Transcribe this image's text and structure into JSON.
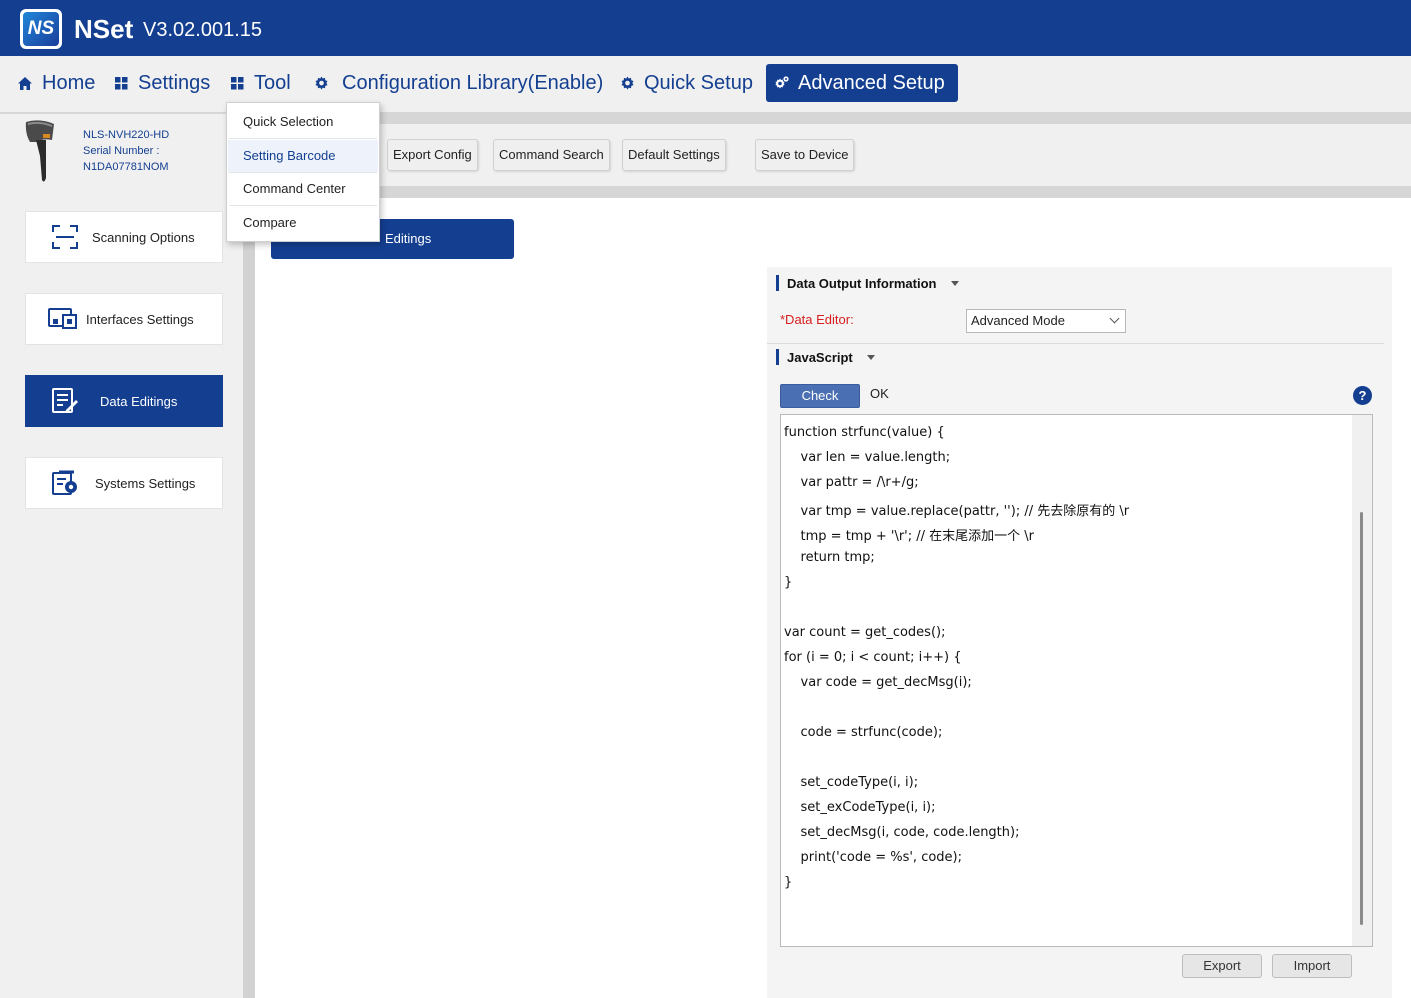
{
  "app": {
    "logo_text": "NS",
    "name": "NSet",
    "version": "V3.02.001.15"
  },
  "nav": [
    {
      "label": "Home",
      "icon": "home-icon"
    },
    {
      "label": "Settings",
      "icon": "grid-icon"
    },
    {
      "label": "Tool",
      "icon": "grid-icon"
    },
    {
      "label": "Configuration Library(Enable)",
      "icon": "gear-icon"
    },
    {
      "label": "Quick Setup",
      "icon": "gear-icon"
    },
    {
      "label": "Advanced Setup",
      "icon": "gears-icon",
      "active": true
    }
  ],
  "device": {
    "model": "NLS-NVH220-HD",
    "serial_label": "Serial Number :",
    "serial_value": "N1DA07781NOM"
  },
  "toolbar": {
    "export_config": "Export Config",
    "command_search": "Command Search",
    "default_settings": "Default Settings",
    "save_to_device": "Save to Device"
  },
  "tool_menu": {
    "items": [
      "Quick Selection",
      "Setting Barcode",
      "Command Center",
      "Compare"
    ],
    "highlighted": "Setting Barcode"
  },
  "sidebar": {
    "items": [
      {
        "label": "Scanning Options",
        "icon": "scan-frame-icon"
      },
      {
        "label": "Interfaces Settings",
        "icon": "interfaces-icon"
      },
      {
        "label": "Data Editings",
        "icon": "data-edit-icon",
        "active": true
      },
      {
        "label": "Systems Settings",
        "icon": "system-settings-icon"
      }
    ]
  },
  "content": {
    "tab_label": "Editings",
    "data_output_title": "Data Output Information",
    "data_editor_label": "*Data Editor:",
    "data_editor_value": "Advanced Mode",
    "javascript_title": "JavaScript",
    "check_button": "Check",
    "check_status": "OK",
    "help": "?",
    "code_lines": [
      "function strfunc(value) {",
      "    var len = value.length;",
      "    var pattr = /\\r+/g;",
      "    var tmp = value.replace(pattr, ''); // 先去除原有的 \\r",
      "    tmp = tmp + '\\r'; // 在末尾添加一个 \\r",
      "    return tmp;",
      "}",
      "",
      "var count = get_codes();",
      "for (i = 0; i < count; i++) {",
      "    var code = get_decMsg(i);",
      "",
      "    code = strfunc(code);",
      "",
      "    set_codeType(i, i);",
      "    set_exCodeType(i, i);",
      "    set_decMsg(i, code, code.length);",
      "    print('code = %s', code);",
      "}"
    ],
    "export_button": "Export",
    "import_button": "Import"
  },
  "colors": {
    "primary": "#143f91",
    "required": "#d71f1f",
    "check_button": "#4a6fb2"
  }
}
